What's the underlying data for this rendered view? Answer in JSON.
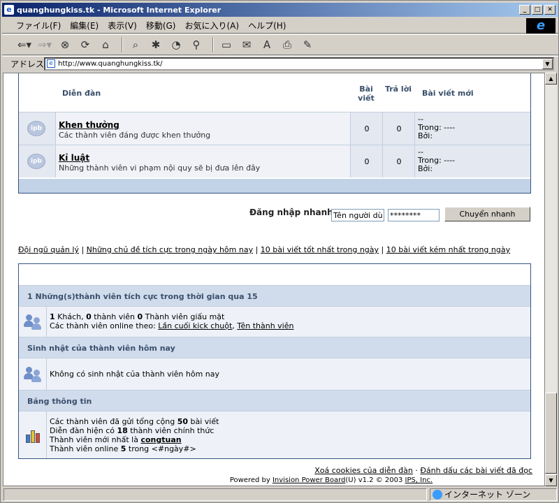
{
  "window": {
    "title": "quanghungkiss.tk - Microsoft Internet Explorer"
  },
  "menu": [
    "ファイル(F)",
    "編集(E)",
    "表示(V)",
    "移動(G)",
    "お気に入り(A)",
    "ヘルプ(H)"
  ],
  "address": {
    "label": "アドレス",
    "url": "http://www.quanghungkiss.tk/"
  },
  "status": {
    "zone": "インターネット ゾーン"
  },
  "forum_table": {
    "headers": {
      "forum": "Diễn đàn",
      "posts": "Bài viết",
      "replies": "Trả lời",
      "last_post": "Bài viết mới"
    },
    "rows": [
      {
        "icon": "ipb",
        "name": "Khen thưởng",
        "desc": "Các thành viên đáng được khen thưởng",
        "posts": "0",
        "replies": "0",
        "last": [
          "--",
          "Trong: ----",
          "Bởi:"
        ]
      },
      {
        "icon": "ipb",
        "name": "Kỉ luật",
        "desc": "Những thành viên vi phạm nội quy sẽ bị đưa lên đây",
        "posts": "0",
        "replies": "0",
        "last": [
          "--",
          "Trong: ----",
          "Bởi:"
        ]
      }
    ]
  },
  "quick_login": {
    "label": "Đăng nhập nhanh",
    "user_value": "Tên người dù",
    "pass_value": "********",
    "button": "Chuyển nhanh"
  },
  "links": [
    "Đội ngũ quản lý",
    "Những chủ đề tích cực trong ngày hôm nay",
    "10 bài viết tốt nhất trong ngày",
    "10 bài viết kém nhất trong ngày"
  ],
  "stats": {
    "active_title": "1 Những(s)thành viên tích cực trong thời gian qua 15",
    "active_counts": {
      "guests": "1",
      "guests_label": " Khách, ",
      "members": "0",
      "members_label": " thành viên ",
      "hidden": "0",
      "hidden_label": " Thành viên giấu mặt"
    },
    "online_by": "Các thành viên online theo: ",
    "online_link1": "Lần cuối kick chuột",
    "online_link2": "Tên thành viên",
    "birthday_title": "Sinh nhật của thành viên hôm nay",
    "birthday_text": "Không có sinh nhật của thành viên hôm nay",
    "board_title": "Bảng thông tin",
    "board": {
      "l1a": "Các thành viên đã gửi tổng cộng ",
      "l1b": "50",
      "l1c": " bài viết",
      "l2a": "Diễn đàn hiện có ",
      "l2b": "18",
      "l2c": " thành viên chính thức",
      "l3a": "Thành viên mới nhất là ",
      "l3b": "congtuan",
      "l4a": "Thành viên online ",
      "l4b": "5",
      "l4c": " trong <#ngày#>"
    }
  },
  "footer": {
    "link1": "Xoá cookies của diễn đàn",
    "sep": " · ",
    "link2": "Đánh dấu các bài viết đã đọc",
    "powered_a": "Powered by ",
    "powered_link": "Invision Power Board",
    "powered_b": "(U) v1.2 © 2003  ",
    "powered_link2": "IPS, Inc."
  }
}
